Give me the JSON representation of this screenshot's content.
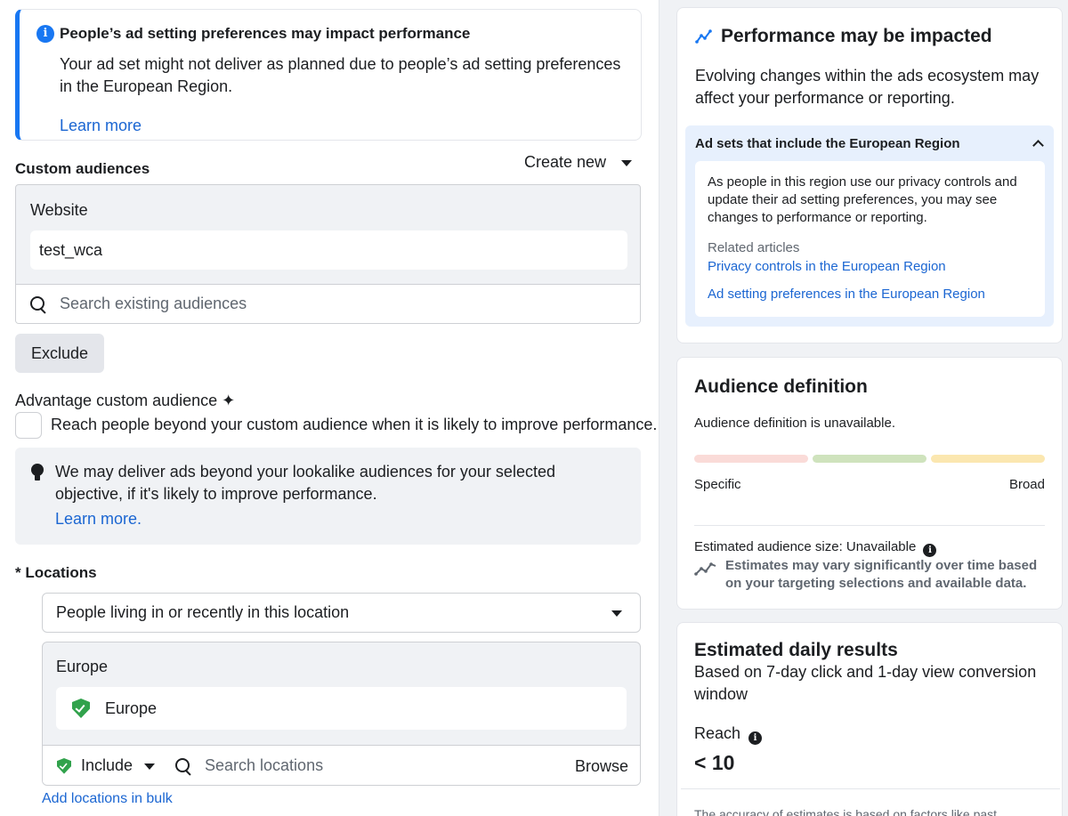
{
  "notice": {
    "title": "People’s ad setting preferences may impact performance",
    "body": "Your ad set might not deliver as planned due to people’s ad setting preferences in the European Region.",
    "learn_more": "Learn more"
  },
  "custom_audiences": {
    "label": "Custom audiences",
    "create_new": "Create new",
    "group_header": "Website",
    "selected": "test_wca",
    "search_placeholder": "Search existing audiences",
    "exclude_label": "Exclude"
  },
  "advantage": {
    "label": "Advantage custom audience ✦",
    "checkbox_label": "Reach people beyond your custom audience when it is likely to improve performance.",
    "checked": false,
    "tip": "We may deliver ads beyond your lookalike audiences for your selected objective, if it's likely to improve performance.",
    "learn_more": "Learn more."
  },
  "locations": {
    "label": "* Locations",
    "type_select": "People living in or recently in this location",
    "group_header": "Europe",
    "selected": "Europe",
    "include_label": "Include",
    "search_placeholder": "Search locations",
    "browse": "Browse",
    "bulk_link": "Add locations in bulk"
  },
  "performance": {
    "title": "Performance may be impacted",
    "description": "Evolving changes within the ads ecosystem may affect your performance or reporting.",
    "accordion_header": "Ad sets that include the European Region",
    "accordion_body": "As people in this region use our privacy controls and update their ad setting preferences, you may see changes to performance or reporting.",
    "related_label": "Related articles",
    "link1": "Privacy controls in the European Region",
    "link2": "Ad setting preferences in the European Region"
  },
  "audience_definition": {
    "title": "Audience definition",
    "status": "Audience definition is unavailable.",
    "specific": "Specific",
    "broad": "Broad",
    "estimated_size": "Estimated audience size: Unavailable",
    "note": "Estimates may vary significantly over time based on your targeting selections and available data.",
    "meter_colors": [
      "#fadbd8",
      "#cfe3bd",
      "#fbe7b0"
    ]
  },
  "daily_results": {
    "title": "Estimated daily results",
    "subtitle": "Based on 7-day click and 1-day view conversion window",
    "reach_label": "Reach",
    "reach_value": "< 10",
    "footer": "The accuracy of estimates is based on factors like past"
  },
  "colors": {
    "accent": "#1877f2",
    "link": "#1b66d2",
    "success": "#31a24c"
  }
}
